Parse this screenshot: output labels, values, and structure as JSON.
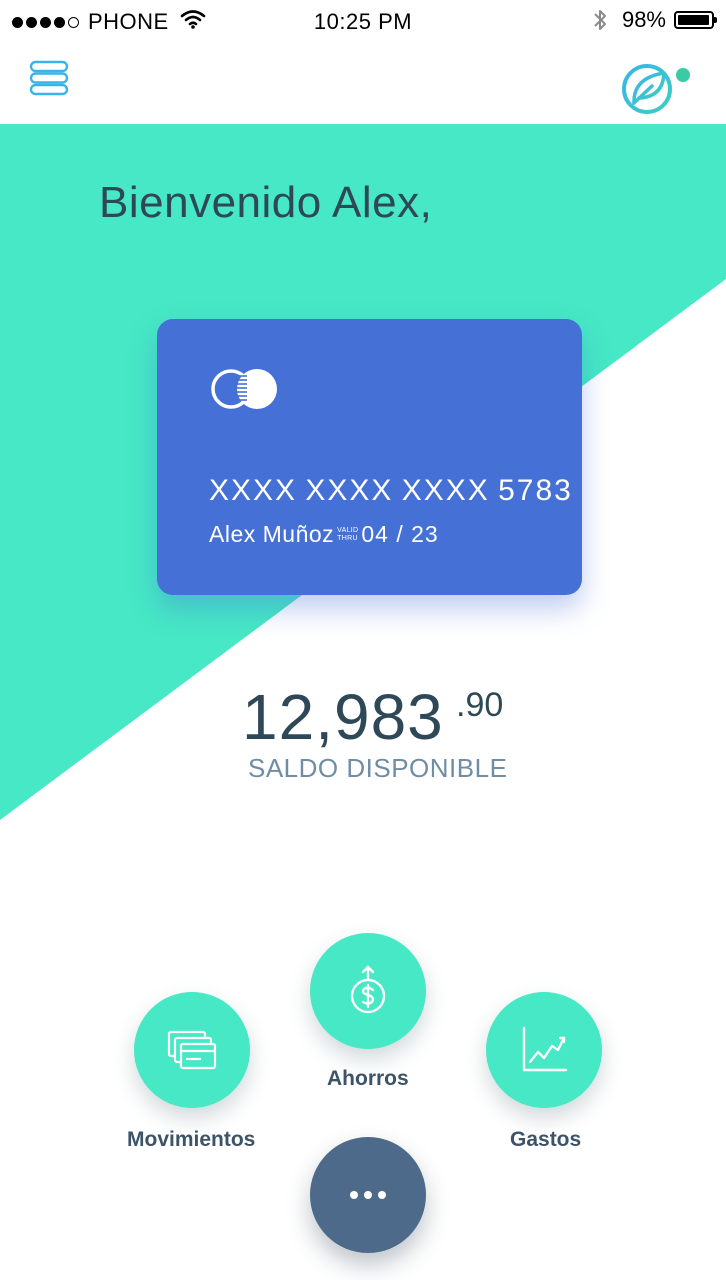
{
  "status_bar": {
    "carrier": "PHONE",
    "time": "10:25 PM",
    "battery": "98%",
    "battery_level": 0.98,
    "signal_bars_filled": 4,
    "signal_bars_total": 5,
    "icons": [
      "wifi-icon",
      "bluetooth-icon",
      "battery-icon"
    ]
  },
  "header": {
    "menu_icon": "menu-stack-icon",
    "logo_icon": "leaf-logo-icon",
    "notification_dot_color": "#3bc9a6"
  },
  "welcome": "Bienvenido Alex,",
  "card": {
    "number": "XXXX XXXX XXXX 5783",
    "holder": "Alex Muñoz",
    "valid_top": "VALID",
    "valid_bottom": "THRU",
    "expiry": "04 / 23",
    "brand_icon": "card-brand-icon"
  },
  "balance": {
    "amount": "12,983",
    "cents": ".90",
    "label": "SALDO DISPONIBLE"
  },
  "actions": [
    {
      "label": "Movimientos",
      "icon": "cards-icon"
    },
    {
      "label": "Ahorros",
      "icon": "savings-coin-icon"
    },
    {
      "label": "Gastos",
      "icon": "line-chart-icon"
    }
  ],
  "more_icon": "more-dots-icon",
  "colors": {
    "accent_green": "#46e8c5",
    "card_blue": "#4570d6",
    "dark_text": "#2f4858",
    "muted_text": "#6f8ea6",
    "more_button": "#4d6a8b",
    "menu_icon": "#3ab4e8"
  }
}
